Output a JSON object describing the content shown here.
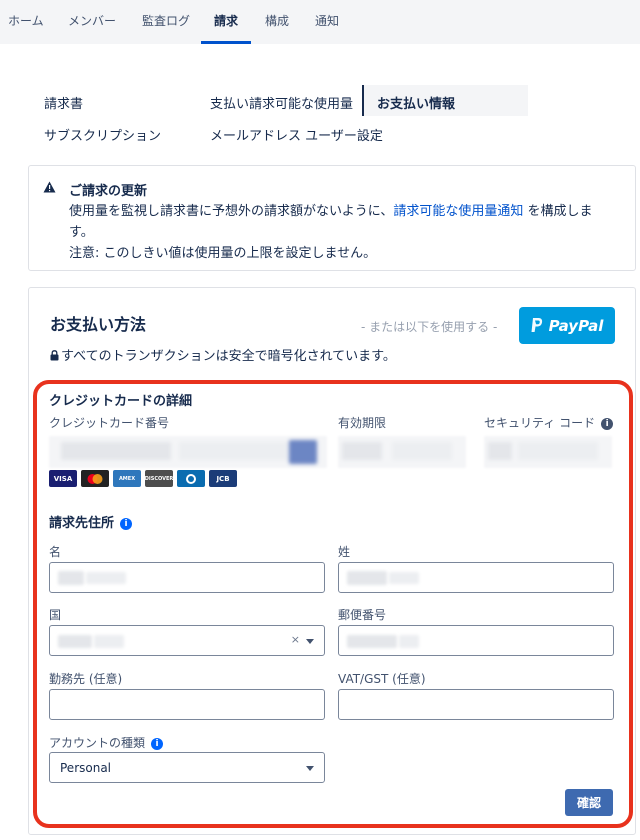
{
  "topnav": {
    "tabs": [
      {
        "label": "ホーム"
      },
      {
        "label": "メンバー"
      },
      {
        "label": "監査ログ"
      },
      {
        "label": "請求"
      },
      {
        "label": "構成"
      },
      {
        "label": "通知"
      }
    ],
    "active_index": 3
  },
  "subnav": {
    "items": [
      {
        "label": "請求書"
      },
      {
        "label": "支払い請求可能な使用量"
      },
      {
        "label": "お支払い情報"
      },
      {
        "label": "サブスクリプション"
      },
      {
        "label": "メールアドレス ユーザー設定"
      }
    ],
    "active_label": "お支払い情報"
  },
  "notice": {
    "title": "ご請求の更新",
    "line1_prefix": "使用量を監視し請求書に予想外の請求額がないように、",
    "link_text": "請求可能な使用量通知",
    "line1_suffix": " を構成しま",
    "line2": "す。",
    "line3": "注意: このしきい値は使用量の上限を設定しません。"
  },
  "payment": {
    "heading": "お支払い方法",
    "alt_text": "- または以下を使用する -",
    "paypal_label": "PayPal",
    "secure_text": "すべてのトランザクションは安全で暗号化されています。",
    "cc_section_title": "クレジットカードの詳細",
    "cc_number_label": "クレジットカード番号",
    "expiry_label": "有効期限",
    "security_code_label": "セキュリティ コード",
    "card_brands": [
      "VISA",
      "Mastercard",
      "AMEX",
      "DISCOVER",
      "Diners Club",
      "JCB"
    ],
    "billing_title": "請求先住所",
    "first_name_label": "名",
    "last_name_label": "姓",
    "country_label": "国",
    "postal_label": "郵便番号",
    "company_label": "勤務先 (任意)",
    "vat_label": "VAT/GST (任意)",
    "account_type_label": "アカウントの種類",
    "account_type_value": "Personal",
    "confirm_label": "確認"
  },
  "colors": {
    "accent": "#0052cc",
    "paypal": "#009cde",
    "confirm": "#3e6ab0",
    "highlight_frame": "#e8321d"
  }
}
